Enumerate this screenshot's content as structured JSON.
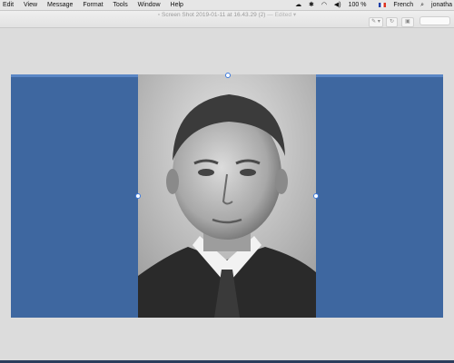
{
  "menubar": {
    "items": [
      "Edit",
      "View",
      "Message",
      "Format",
      "Tools",
      "Window",
      "Help"
    ],
    "battery": "100 %",
    "input_source": "French",
    "user": "jonatha"
  },
  "window": {
    "title": "Screen Shot 2019-01-11 at 16.43.29 (2)",
    "state": "Edited"
  },
  "colors": {
    "panel_blue": "#3e67a0",
    "menubar_bg": "#e6e6e6",
    "canvas_bg": "#dcdcdc"
  }
}
